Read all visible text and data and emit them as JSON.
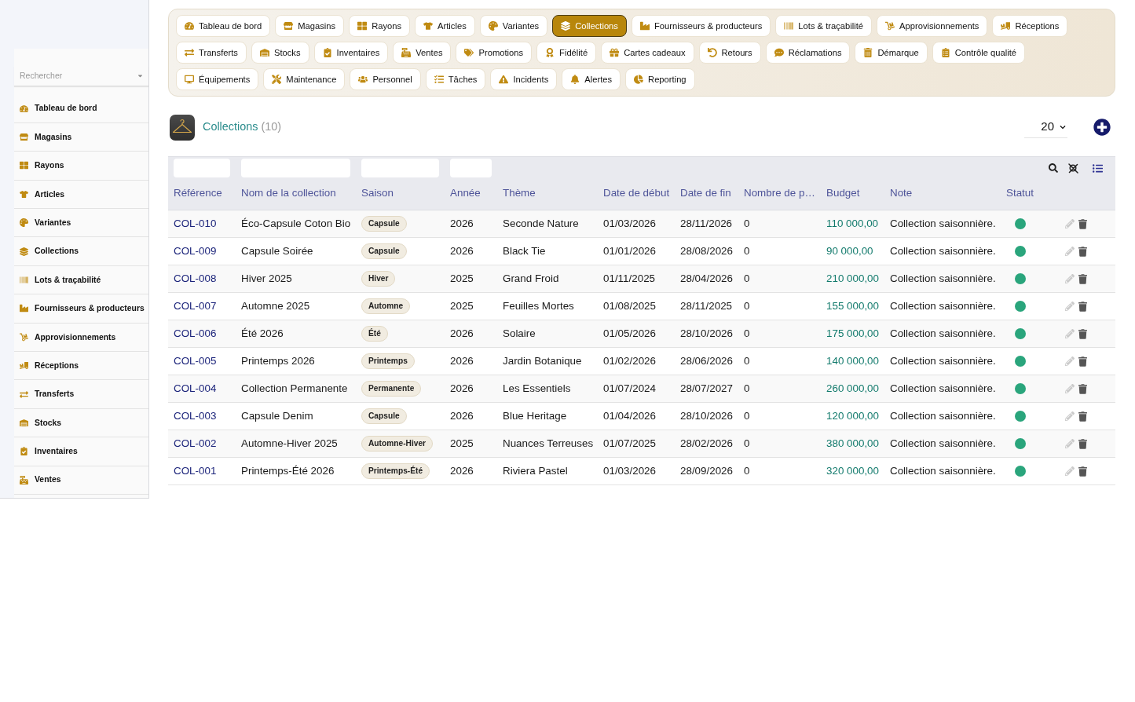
{
  "sidebar": {
    "search": {
      "placeholder": "Rechercher"
    },
    "items": [
      {
        "label": "Tableau de bord",
        "selected": false
      },
      {
        "label": "Magasins",
        "selected": false
      },
      {
        "label": "Rayons",
        "selected": false
      },
      {
        "label": "Articles",
        "selected": false
      },
      {
        "label": "Variantes",
        "selected": false
      },
      {
        "label": "Collections",
        "selected": false
      },
      {
        "label": "Lots & traçabilité",
        "selected": false
      },
      {
        "label": "Fournisseurs & producteurs",
        "selected": false
      },
      {
        "label": "Approvisionnements",
        "selected": false
      },
      {
        "label": "Réceptions",
        "selected": false
      },
      {
        "label": "Transferts",
        "selected": false
      },
      {
        "label": "Stocks",
        "selected": false
      },
      {
        "label": "Inventaires",
        "selected": false
      },
      {
        "label": "Ventes",
        "selected": false
      }
    ]
  },
  "nav": {
    "buttons": [
      {
        "label": "Tableau de bord",
        "selected": false
      },
      {
        "label": "Magasins",
        "selected": false
      },
      {
        "label": "Rayons",
        "selected": false
      },
      {
        "label": "Articles",
        "selected": false
      },
      {
        "label": "Variantes",
        "selected": false
      },
      {
        "label": "Collections",
        "selected": true
      },
      {
        "label": "Fournisseurs & producteurs",
        "selected": false
      },
      {
        "label": "Lots & traçabilité",
        "selected": false
      },
      {
        "label": "Approvisionnements",
        "selected": false
      },
      {
        "label": "Réceptions",
        "selected": false
      },
      {
        "label": "Transferts",
        "selected": false
      },
      {
        "label": "Stocks",
        "selected": false
      },
      {
        "label": "Inventaires",
        "selected": false
      },
      {
        "label": "Ventes",
        "selected": false
      },
      {
        "label": "Promotions",
        "selected": false
      },
      {
        "label": "Fidélité",
        "selected": false
      },
      {
        "label": "Cartes cadeaux",
        "selected": false
      },
      {
        "label": "Retours",
        "selected": false
      },
      {
        "label": "Réclamations",
        "selected": false
      },
      {
        "label": "Démarque",
        "selected": false
      },
      {
        "label": "Contrôle qualité",
        "selected": false
      },
      {
        "label": "Équipements",
        "selected": false
      },
      {
        "label": "Maintenance",
        "selected": false
      },
      {
        "label": "Personnel",
        "selected": false
      },
      {
        "label": "Tâches",
        "selected": false
      },
      {
        "label": "Incidents",
        "selected": false
      },
      {
        "label": "Alertes",
        "selected": false
      },
      {
        "label": "Reporting",
        "selected": false
      }
    ]
  },
  "header": {
    "title": "Collections",
    "count": "(10)",
    "page_size": "20"
  },
  "table": {
    "columns": [
      {
        "label": "Référence",
        "filter": true
      },
      {
        "label": "Nom de la collection",
        "filter": true
      },
      {
        "label": "Saison",
        "filter": true
      },
      {
        "label": "Année",
        "filter": true
      },
      {
        "label": "Thème",
        "filter": false
      },
      {
        "label": "Date de début",
        "filter": false
      },
      {
        "label": "Date de fin",
        "filter": false
      },
      {
        "label": "Nombre de p…",
        "filter": false
      },
      {
        "label": "Budget",
        "filter": false
      },
      {
        "label": "Note",
        "filter": false
      },
      {
        "label": "Statut",
        "filter": false
      }
    ],
    "rows": [
      {
        "reference": "COL-010",
        "name": "Éco-Capsule Coton Bio",
        "season": "Capsule",
        "year": "2026",
        "theme": "Seconde Nature",
        "start": "01/03/2026",
        "end": "28/11/2026",
        "count": "0",
        "budget": "110 000,00",
        "note": "Collection saisonnière.",
        "status": {
          "color": "#2aa57c"
        }
      },
      {
        "reference": "COL-009",
        "name": "Capsule Soirée",
        "season": "Capsule",
        "year": "2026",
        "theme": "Black Tie",
        "start": "01/01/2026",
        "end": "28/08/2026",
        "count": "0",
        "budget": "90 000,00",
        "note": "Collection saisonnière.",
        "status": {
          "color": "#2aa57c"
        }
      },
      {
        "reference": "COL-008",
        "name": "Hiver 2025",
        "season": "Hiver",
        "year": "2025",
        "theme": "Grand Froid",
        "start": "01/11/2025",
        "end": "28/04/2026",
        "count": "0",
        "budget": "210 000,00",
        "note": "Collection saisonnière.",
        "status": {
          "color": "#2aa57c"
        }
      },
      {
        "reference": "COL-007",
        "name": "Automne 2025",
        "season": "Automne",
        "year": "2025",
        "theme": "Feuilles Mortes",
        "start": "01/08/2025",
        "end": "28/11/2025",
        "count": "0",
        "budget": "155 000,00",
        "note": "Collection saisonnière.",
        "status": {
          "color": "#2aa57c"
        }
      },
      {
        "reference": "COL-006",
        "name": "Été 2026",
        "season": "Été",
        "year": "2026",
        "theme": "Solaire",
        "start": "01/05/2026",
        "end": "28/10/2026",
        "count": "0",
        "budget": "175 000,00",
        "note": "Collection saisonnière.",
        "status": {
          "color": "#2aa57c"
        }
      },
      {
        "reference": "COL-005",
        "name": "Printemps 2026",
        "season": "Printemps",
        "year": "2026",
        "theme": "Jardin Botanique",
        "start": "01/02/2026",
        "end": "28/06/2026",
        "count": "0",
        "budget": "140 000,00",
        "note": "Collection saisonnière.",
        "status": {
          "color": "#2aa57c"
        }
      },
      {
        "reference": "COL-004",
        "name": "Collection Permanente",
        "season": "Permanente",
        "year": "2026",
        "theme": "Les Essentiels",
        "start": "01/07/2024",
        "end": "28/07/2027",
        "count": "0",
        "budget": "260 000,00",
        "note": "Collection saisonnière.",
        "status": {
          "color": "#2aa57c"
        }
      },
      {
        "reference": "COL-003",
        "name": "Capsule Denim",
        "season": "Capsule",
        "year": "2026",
        "theme": "Blue Heritage",
        "start": "01/04/2026",
        "end": "28/10/2026",
        "count": "0",
        "budget": "120 000,00",
        "note": "Collection saisonnière.",
        "status": {
          "color": "#2aa57c"
        }
      },
      {
        "reference": "COL-002",
        "name": "Automne-Hiver 2025",
        "season": "Automne-Hiver",
        "year": "2025",
        "theme": "Nuances Terreuses",
        "start": "01/07/2025",
        "end": "28/02/2026",
        "count": "0",
        "budget": "380 000,00",
        "note": "Collection saisonnière.",
        "status": {
          "color": "#2aa57c"
        }
      },
      {
        "reference": "COL-001",
        "name": "Printemps-Été 2026",
        "season": "Printemps-Été",
        "year": "2026",
        "theme": "Riviera Pastel",
        "start": "01/03/2026",
        "end": "28/09/2026",
        "count": "0",
        "budget": "320 000,00",
        "note": "Collection saisonnière.",
        "status": {
          "color": "#2aa57c"
        }
      }
    ]
  }
}
